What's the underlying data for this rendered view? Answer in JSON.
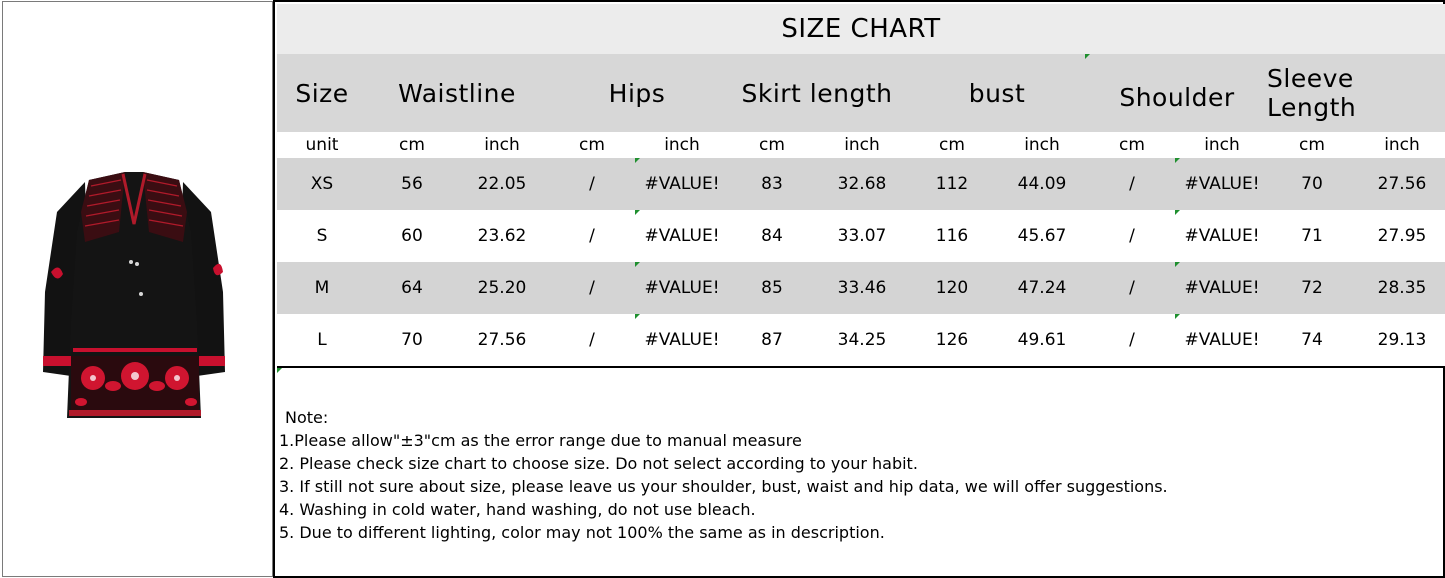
{
  "title": "SIZE CHART",
  "headers": [
    "Size",
    "Waistline",
    "Hips",
    "Skirt length",
    "bust",
    "Shoulder",
    "Sleeve Length"
  ],
  "units": [
    "unit",
    "cm",
    "inch",
    "cm",
    "inch",
    "cm",
    "inch",
    "cm",
    "inch",
    "cm",
    "inch",
    "cm",
    "inch"
  ],
  "rows": [
    [
      "XS",
      "56",
      "22.05",
      "/",
      "#VALUE!",
      "83",
      "32.68",
      "112",
      "44.09",
      "/",
      "#VALUE!",
      "70",
      "27.56"
    ],
    [
      "S",
      "60",
      "23.62",
      "/",
      "#VALUE!",
      "84",
      "33.07",
      "116",
      "45.67",
      "/",
      "#VALUE!",
      "71",
      "27.95"
    ],
    [
      "M",
      "64",
      "25.20",
      "/",
      "#VALUE!",
      "85",
      "33.46",
      "120",
      "47.24",
      "/",
      "#VALUE!",
      "72",
      "28.35"
    ],
    [
      "L",
      "70",
      "27.56",
      "/",
      "#VALUE!",
      "87",
      "34.25",
      "126",
      "49.61",
      "/",
      "#VALUE!",
      "74",
      "29.13"
    ]
  ],
  "notes": {
    "heading": "Note:",
    "lines": [
      "1.Please allow\"±3\"cm as the error range due to manual measure",
      "2. Please check size chart to choose size. Do not select according to your habit.",
      "3. If still not sure about size, please leave us your shoulder, bust, waist and hip data, we will offer suggestions.",
      "4. Washing in cold water, hand washing, do not use bleach.",
      "5. Due to different lighting, color may not 100% the same as in description."
    ]
  },
  "colors": {
    "title_bg": "#ececec",
    "header_bg": "#d7d7d7",
    "row_shade": "#d4d4d4",
    "garment_black": "#111111",
    "embroidery_red": "#c8102e",
    "error_marker": "#1f8f2f"
  }
}
